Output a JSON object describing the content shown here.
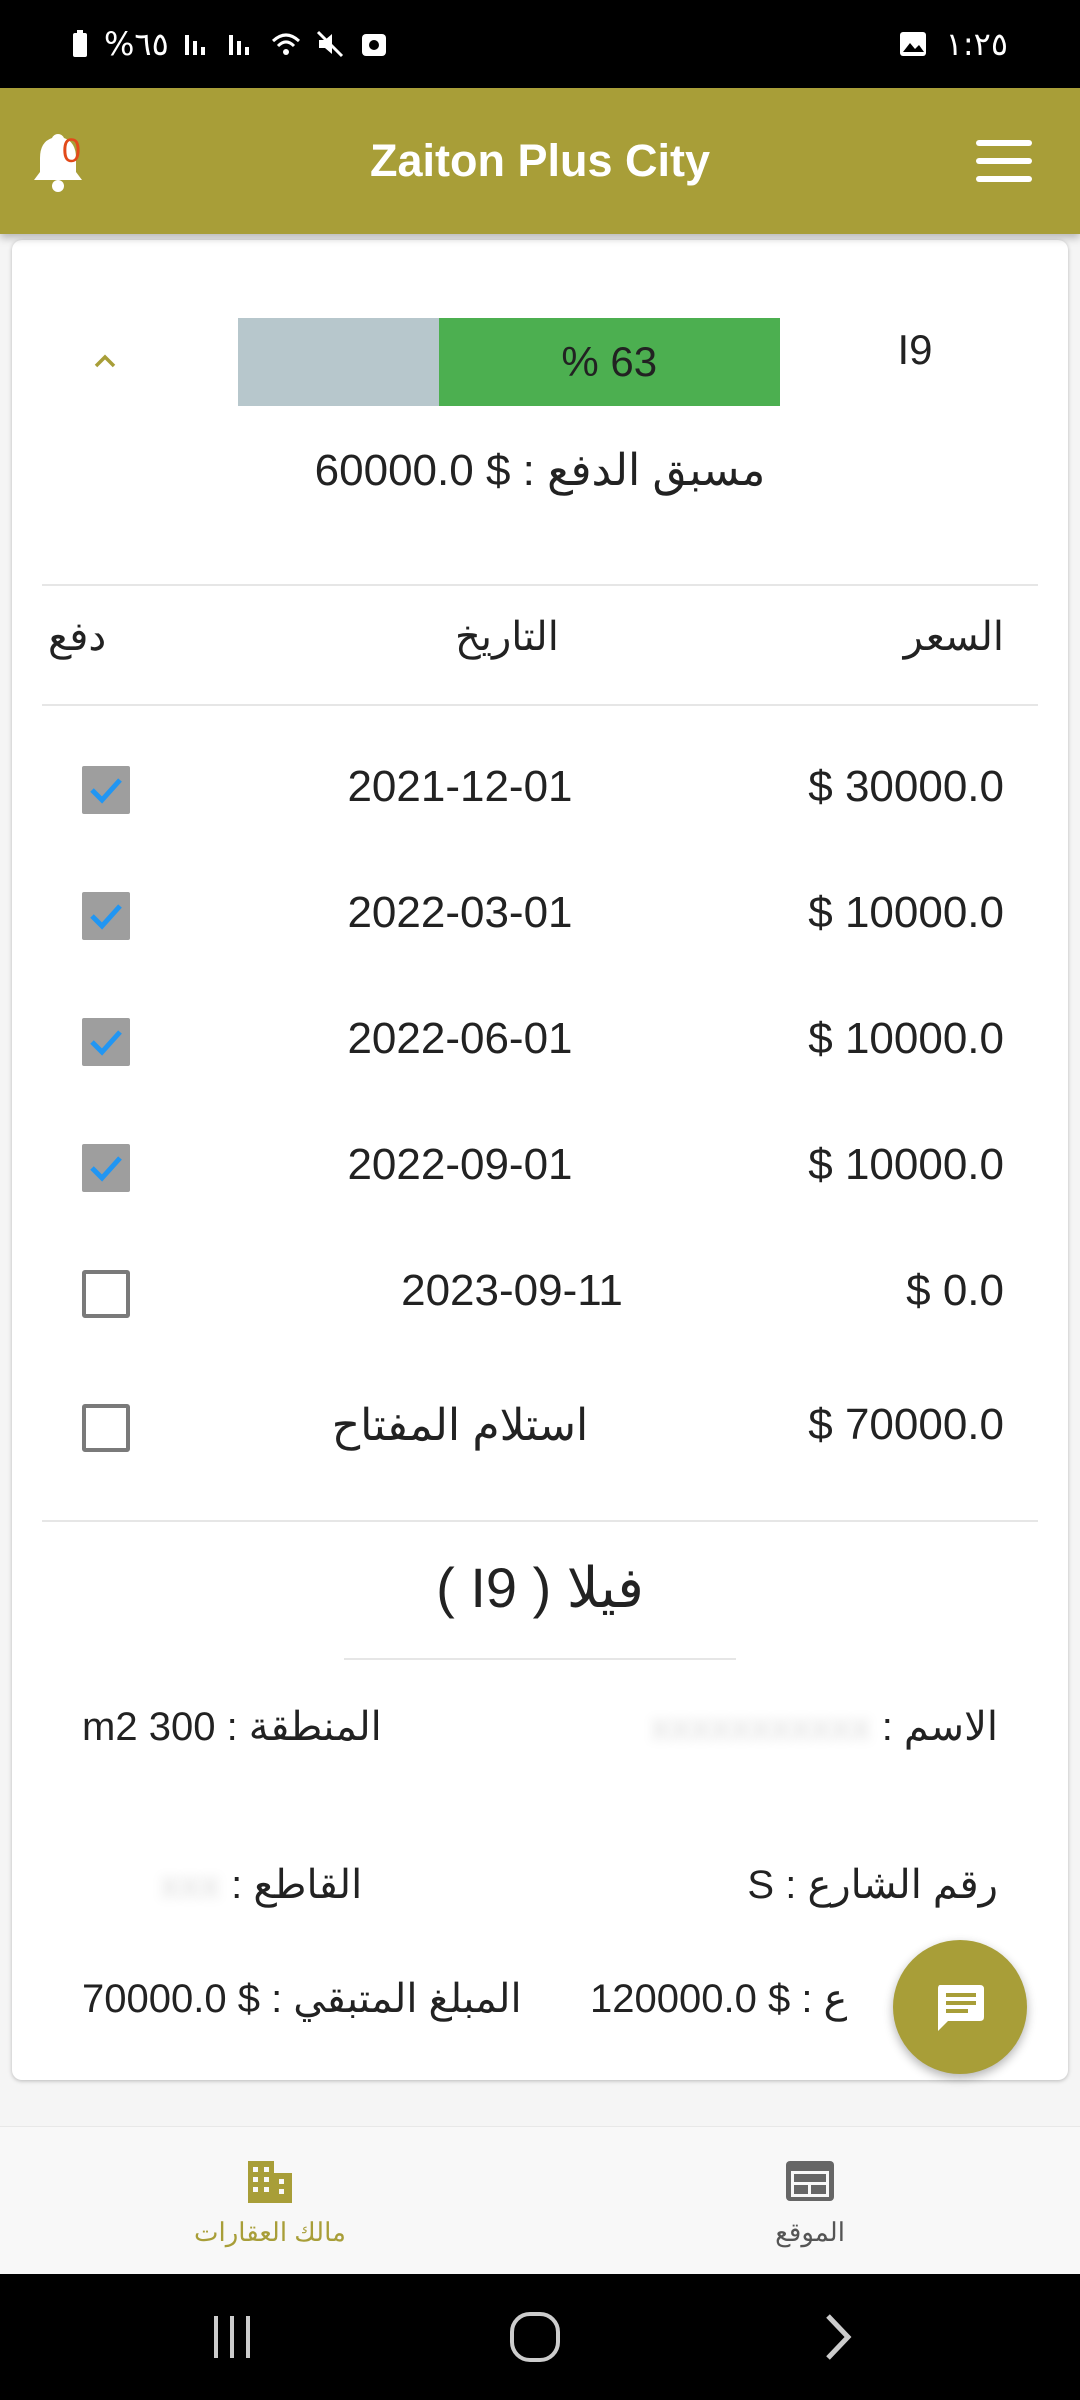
{
  "status_bar": {
    "battery": "%٦٥",
    "time": "١:٢٥"
  },
  "app_bar": {
    "title": "Zaiton Plus City",
    "notification_count": "0"
  },
  "unit": {
    "code": "I9",
    "progress_label": "% 63",
    "progress_percent": 63,
    "advance_payment": "مسبق الدفع : $ 60000.0"
  },
  "table": {
    "headers": {
      "price": "السعر",
      "date": "التاريخ",
      "paid": "دفع"
    },
    "rows": [
      {
        "price": "$ 30000.0",
        "date": "2021-12-01",
        "paid": true
      },
      {
        "price": "$ 10000.0",
        "date": "2022-03-01",
        "paid": true
      },
      {
        "price": "$ 10000.0",
        "date": "2022-06-01",
        "paid": true
      },
      {
        "price": "$ 10000.0",
        "date": "2022-09-01",
        "paid": true
      },
      {
        "price": "$ 0.0",
        "date": "2023-09-11",
        "paid": false
      },
      {
        "price": "$ 70000.0",
        "date": "استلام المفتاح",
        "paid": false
      }
    ]
  },
  "details": {
    "villa_title": "فيلا ( I9 )",
    "name_label": "الاسم :",
    "area_label": "المنطقة :",
    "area_value": "300 m2",
    "street_label": "رقم الشارع :",
    "street_value": "S",
    "sector_label": "القاطع :",
    "total_label": "ع : $",
    "total_value": "120000.0",
    "remaining_label": "المبلغ المتبقي : $",
    "remaining_value": "70000.0"
  },
  "bottom_nav": {
    "items": [
      {
        "label": "مالك العقارات",
        "icon": "building-icon",
        "active": true
      },
      {
        "label": "الموقع",
        "icon": "web-icon",
        "active": false
      }
    ]
  },
  "colors": {
    "primary": "#a89e38",
    "progress_fill": "#4caf50",
    "progress_track": "#b7c7cc",
    "check": "#2196f3"
  }
}
